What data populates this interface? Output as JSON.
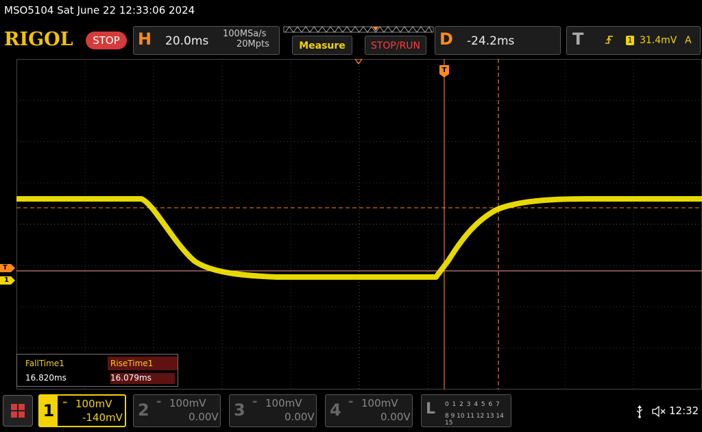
{
  "title_bar": {
    "text": "MSO5104  Sat June 22 12:33:06 2024"
  },
  "brand": {
    "logo": "RIGOL",
    "run_state": "STOP"
  },
  "horizontal": {
    "letter": "H",
    "timebase": "20.0ms",
    "sample_rate": "100MSa/s",
    "memory_depth": "20Mpts"
  },
  "buttons": {
    "measure": "Measure",
    "stop_run": "STOP/RUN"
  },
  "delay": {
    "letter": "D",
    "value": "-24.2ms"
  },
  "trigger": {
    "letter": "T",
    "source": "1",
    "level": "31.4mV",
    "mode": "A",
    "edge_icon": "rising-edge-icon"
  },
  "markers": {
    "trigger_marker": "T",
    "ch1_marker": "1"
  },
  "measurements": {
    "fall_label": "FallTime1",
    "fall_value": "16.820ms",
    "rise_label": "RiseTime1",
    "rise_value": "16.079ms"
  },
  "channels": [
    {
      "num": "1",
      "scale": "100mV",
      "offset": "-140mV",
      "active": true,
      "color": "#f2d400"
    },
    {
      "num": "2",
      "scale": "100mV",
      "offset": "0.00V",
      "active": false
    },
    {
      "num": "3",
      "scale": "100mV",
      "offset": "0.00V",
      "active": false
    },
    {
      "num": "4",
      "scale": "100mV",
      "offset": "0.00V",
      "active": false
    }
  ],
  "logic": {
    "letter": "L",
    "row1": "0 1 2 3   4 5 6 7",
    "row2": "8 9 10 11 12 13 14 15"
  },
  "status": {
    "clock": "12:32"
  },
  "colors": {
    "ch1": "#f2d400",
    "trigger": "#ff8a1c",
    "accent": "#f2c400",
    "stop": "#d43b3b"
  }
}
